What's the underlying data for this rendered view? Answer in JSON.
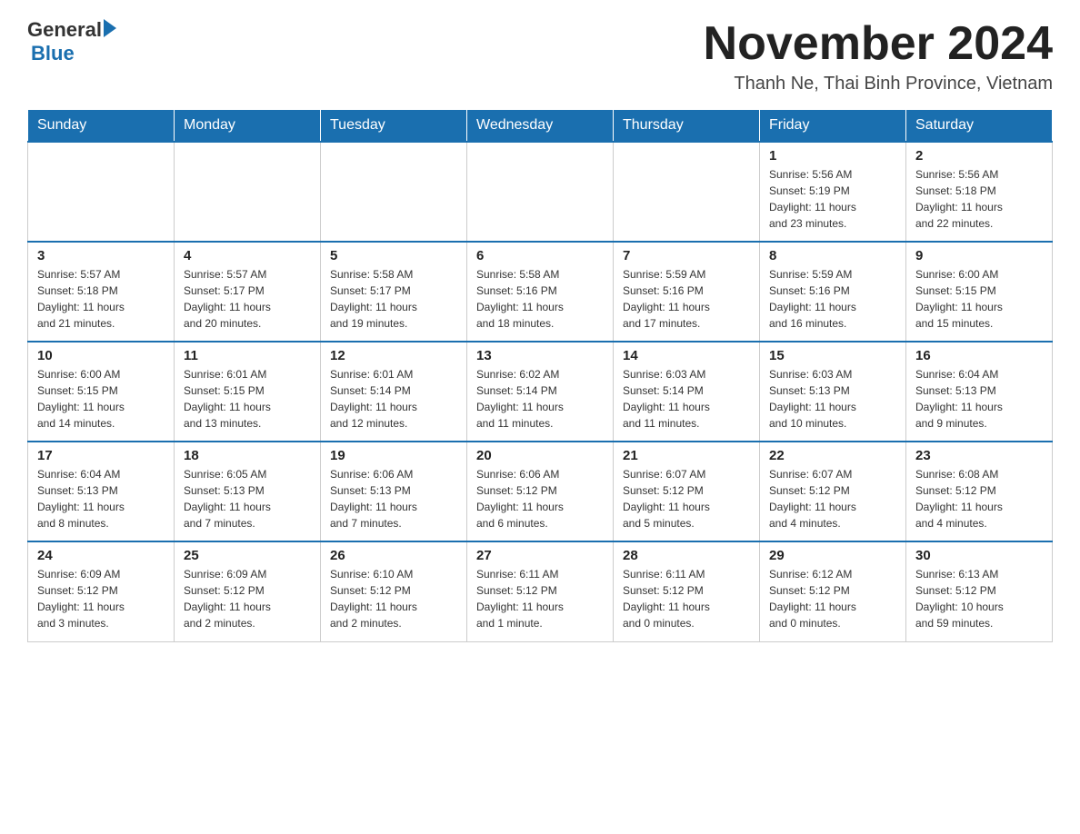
{
  "header": {
    "logo_general": "General",
    "logo_blue": "Blue",
    "title": "November 2024",
    "location": "Thanh Ne, Thai Binh Province, Vietnam"
  },
  "weekdays": [
    "Sunday",
    "Monday",
    "Tuesday",
    "Wednesday",
    "Thursday",
    "Friday",
    "Saturday"
  ],
  "weeks": [
    [
      {
        "day": "",
        "info": ""
      },
      {
        "day": "",
        "info": ""
      },
      {
        "day": "",
        "info": ""
      },
      {
        "day": "",
        "info": ""
      },
      {
        "day": "",
        "info": ""
      },
      {
        "day": "1",
        "info": "Sunrise: 5:56 AM\nSunset: 5:19 PM\nDaylight: 11 hours\nand 23 minutes."
      },
      {
        "day": "2",
        "info": "Sunrise: 5:56 AM\nSunset: 5:18 PM\nDaylight: 11 hours\nand 22 minutes."
      }
    ],
    [
      {
        "day": "3",
        "info": "Sunrise: 5:57 AM\nSunset: 5:18 PM\nDaylight: 11 hours\nand 21 minutes."
      },
      {
        "day": "4",
        "info": "Sunrise: 5:57 AM\nSunset: 5:17 PM\nDaylight: 11 hours\nand 20 minutes."
      },
      {
        "day": "5",
        "info": "Sunrise: 5:58 AM\nSunset: 5:17 PM\nDaylight: 11 hours\nand 19 minutes."
      },
      {
        "day": "6",
        "info": "Sunrise: 5:58 AM\nSunset: 5:16 PM\nDaylight: 11 hours\nand 18 minutes."
      },
      {
        "day": "7",
        "info": "Sunrise: 5:59 AM\nSunset: 5:16 PM\nDaylight: 11 hours\nand 17 minutes."
      },
      {
        "day": "8",
        "info": "Sunrise: 5:59 AM\nSunset: 5:16 PM\nDaylight: 11 hours\nand 16 minutes."
      },
      {
        "day": "9",
        "info": "Sunrise: 6:00 AM\nSunset: 5:15 PM\nDaylight: 11 hours\nand 15 minutes."
      }
    ],
    [
      {
        "day": "10",
        "info": "Sunrise: 6:00 AM\nSunset: 5:15 PM\nDaylight: 11 hours\nand 14 minutes."
      },
      {
        "day": "11",
        "info": "Sunrise: 6:01 AM\nSunset: 5:15 PM\nDaylight: 11 hours\nand 13 minutes."
      },
      {
        "day": "12",
        "info": "Sunrise: 6:01 AM\nSunset: 5:14 PM\nDaylight: 11 hours\nand 12 minutes."
      },
      {
        "day": "13",
        "info": "Sunrise: 6:02 AM\nSunset: 5:14 PM\nDaylight: 11 hours\nand 11 minutes."
      },
      {
        "day": "14",
        "info": "Sunrise: 6:03 AM\nSunset: 5:14 PM\nDaylight: 11 hours\nand 11 minutes."
      },
      {
        "day": "15",
        "info": "Sunrise: 6:03 AM\nSunset: 5:13 PM\nDaylight: 11 hours\nand 10 minutes."
      },
      {
        "day": "16",
        "info": "Sunrise: 6:04 AM\nSunset: 5:13 PM\nDaylight: 11 hours\nand 9 minutes."
      }
    ],
    [
      {
        "day": "17",
        "info": "Sunrise: 6:04 AM\nSunset: 5:13 PM\nDaylight: 11 hours\nand 8 minutes."
      },
      {
        "day": "18",
        "info": "Sunrise: 6:05 AM\nSunset: 5:13 PM\nDaylight: 11 hours\nand 7 minutes."
      },
      {
        "day": "19",
        "info": "Sunrise: 6:06 AM\nSunset: 5:13 PM\nDaylight: 11 hours\nand 7 minutes."
      },
      {
        "day": "20",
        "info": "Sunrise: 6:06 AM\nSunset: 5:12 PM\nDaylight: 11 hours\nand 6 minutes."
      },
      {
        "day": "21",
        "info": "Sunrise: 6:07 AM\nSunset: 5:12 PM\nDaylight: 11 hours\nand 5 minutes."
      },
      {
        "day": "22",
        "info": "Sunrise: 6:07 AM\nSunset: 5:12 PM\nDaylight: 11 hours\nand 4 minutes."
      },
      {
        "day": "23",
        "info": "Sunrise: 6:08 AM\nSunset: 5:12 PM\nDaylight: 11 hours\nand 4 minutes."
      }
    ],
    [
      {
        "day": "24",
        "info": "Sunrise: 6:09 AM\nSunset: 5:12 PM\nDaylight: 11 hours\nand 3 minutes."
      },
      {
        "day": "25",
        "info": "Sunrise: 6:09 AM\nSunset: 5:12 PM\nDaylight: 11 hours\nand 2 minutes."
      },
      {
        "day": "26",
        "info": "Sunrise: 6:10 AM\nSunset: 5:12 PM\nDaylight: 11 hours\nand 2 minutes."
      },
      {
        "day": "27",
        "info": "Sunrise: 6:11 AM\nSunset: 5:12 PM\nDaylight: 11 hours\nand 1 minute."
      },
      {
        "day": "28",
        "info": "Sunrise: 6:11 AM\nSunset: 5:12 PM\nDaylight: 11 hours\nand 0 minutes."
      },
      {
        "day": "29",
        "info": "Sunrise: 6:12 AM\nSunset: 5:12 PM\nDaylight: 11 hours\nand 0 minutes."
      },
      {
        "day": "30",
        "info": "Sunrise: 6:13 AM\nSunset: 5:12 PM\nDaylight: 10 hours\nand 59 minutes."
      }
    ]
  ]
}
